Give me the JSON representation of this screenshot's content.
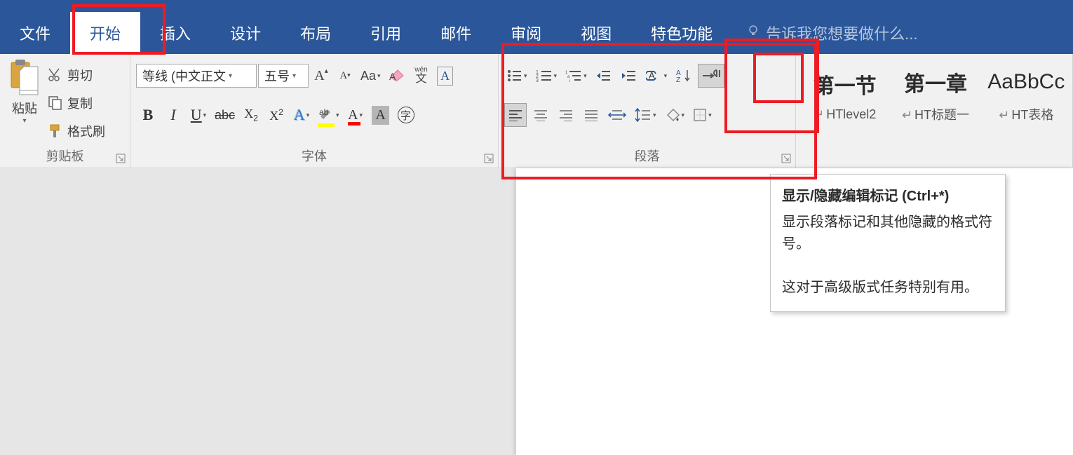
{
  "tabs": {
    "file": "文件",
    "home": "开始",
    "insert": "插入",
    "design": "设计",
    "layout": "布局",
    "references": "引用",
    "mailings": "邮件",
    "review": "审阅",
    "view": "视图",
    "special": "特色功能",
    "tell_me": "告诉我您想要做什么..."
  },
  "clipboard": {
    "paste": "粘贴",
    "cut": "剪切",
    "copy": "复制",
    "format_painter": "格式刷",
    "group_label": "剪贴板"
  },
  "font": {
    "font_name": "等线 (中文正文",
    "font_size": "五号",
    "pinyin": "wén",
    "pinyin_char": "文",
    "boxA": "A",
    "group_label": "字体"
  },
  "paragraph": {
    "group_label": "段落"
  },
  "styles": {
    "s1_sample": "第一节",
    "s1_name": "HTlevel2",
    "s2_sample": "第一章",
    "s2_name": "HT标题一",
    "s3_sample": "AaBbCc",
    "s3_name": "HT表格"
  },
  "tooltip": {
    "title": "显示/隐藏编辑标记 (Ctrl+*)",
    "body1": "显示段落标记和其他隐藏的格式符号。",
    "body2": "这对于高级版式任务特别有用。"
  }
}
